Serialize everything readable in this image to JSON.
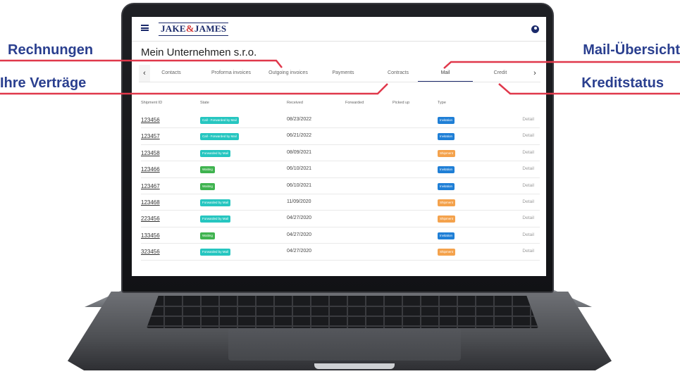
{
  "callouts": {
    "rechnungen": "Rechnungen",
    "vertraege": "Ihre Verträge",
    "mail_uebersicht": "Mail-Übersicht",
    "kreditstatus": "Kreditstatus"
  },
  "colors": {
    "brand_navy": "#1b2a6b",
    "callout_blue": "#2a3f8f",
    "callout_line": "#e0384b",
    "state_teal": "#26c6c0",
    "state_green": "#3fb34f",
    "type_blue": "#1f7fd6",
    "type_orange": "#f4a24c"
  },
  "app": {
    "logo_left": "JAKE",
    "logo_amp": "&",
    "logo_right": "JAMES",
    "page_title": "Mein Unternehmen s.r.o."
  },
  "tabs": {
    "prev": "‹",
    "next": "›",
    "items": [
      "Contacts",
      "Proforma invoices",
      "Outgoing invoices",
      "Payments",
      "Contracts",
      "Mail",
      "Credit"
    ],
    "active": "Mail"
  },
  "table": {
    "headers": [
      "Shipment ID",
      "State",
      "Received",
      "Forwarded",
      "Picked up",
      "Type"
    ],
    "rows": [
      {
        "id": "123456",
        "state": "Call - Forwarded by Mail",
        "state_kind": "teal",
        "received": "08/23/2022",
        "type": "Invitation",
        "type_kind": "blue",
        "detail": "Detail"
      },
      {
        "id": "123457",
        "state": "Call - Forwarded by Mail",
        "state_kind": "teal",
        "received": "06/21/2022",
        "type": "Invitation",
        "type_kind": "blue",
        "detail": "Detail"
      },
      {
        "id": "123458",
        "state": "Forwarded by Mail",
        "state_kind": "teal",
        "received": "08/09/2021",
        "type": "Shipment",
        "type_kind": "orange",
        "detail": "Detail"
      },
      {
        "id": "123466",
        "state": "Waiting",
        "state_kind": "green",
        "received": "06/10/2021",
        "type": "Invitation",
        "type_kind": "blue",
        "detail": "Detail"
      },
      {
        "id": "123467",
        "state": "Waiting",
        "state_kind": "green",
        "received": "06/10/2021",
        "type": "Invitation",
        "type_kind": "blue",
        "detail": "Detail"
      },
      {
        "id": "123468",
        "state": "Forwarded by Mail",
        "state_kind": "teal",
        "received": "11/09/2020",
        "type": "Shipment",
        "type_kind": "orange",
        "detail": "Detail"
      },
      {
        "id": "223456",
        "state": "Forwarded by Mail",
        "state_kind": "teal",
        "received": "04/27/2020",
        "type": "Shipment",
        "type_kind": "orange",
        "detail": "Detail"
      },
      {
        "id": "133456",
        "state": "Waiting",
        "state_kind": "green",
        "received": "04/27/2020",
        "type": "Invitation",
        "type_kind": "blue",
        "detail": "Detail"
      },
      {
        "id": "323456",
        "state": "Forwarded by Mail",
        "state_kind": "teal",
        "received": "04/27/2020",
        "type": "Shipment",
        "type_kind": "orange",
        "detail": "Detail"
      }
    ]
  }
}
